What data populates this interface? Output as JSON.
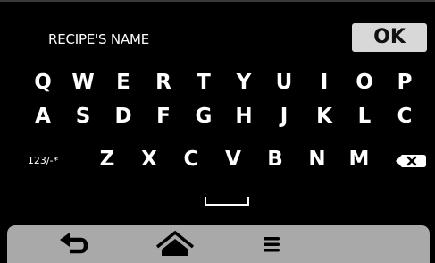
{
  "header": {
    "field_label": "RECIPE'S NAME",
    "ok_label": "OK"
  },
  "keyboard": {
    "row1": [
      "Q",
      "W",
      "E",
      "R",
      "T",
      "Y",
      "U",
      "I",
      "O",
      "P"
    ],
    "row2": [
      "A",
      "S",
      "D",
      "F",
      "G",
      "H",
      "J",
      "K",
      "L",
      "C"
    ],
    "row3": [
      "Z",
      "X",
      "C",
      "V",
      "B",
      "N",
      "M"
    ],
    "mode_key_label": "123/-*",
    "backspace_icon": "backspace-icon",
    "space_icon": "space-bar-icon"
  },
  "nav_bar": {
    "items": [
      {
        "icon": "back-arrow-icon"
      },
      {
        "icon": "home-icon"
      },
      {
        "icon": "menu-icon"
      }
    ]
  },
  "colors": {
    "screen_bg": "#000000",
    "key_text": "#ffffff",
    "ok_bg": "#d8d8d8",
    "nav_bg": "#a9a9a9"
  }
}
